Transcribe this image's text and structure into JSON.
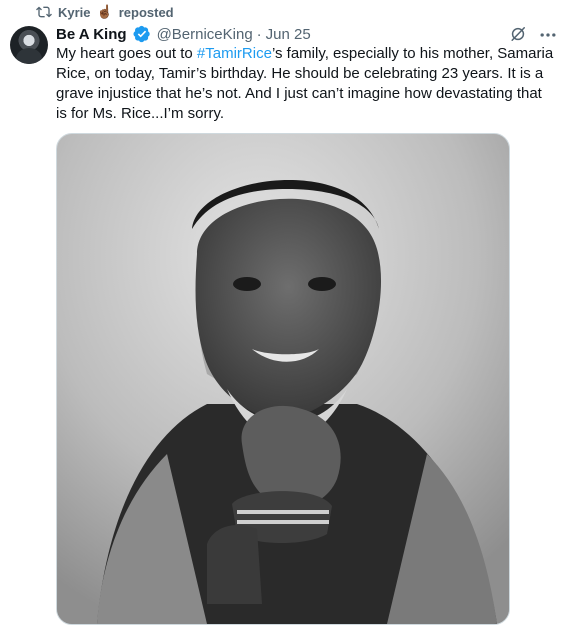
{
  "repost": {
    "icon": "repost-icon",
    "user": "Kyrie",
    "emoji": "☝🏾",
    "label": "reposted"
  },
  "author": {
    "avatar": "avatar",
    "name": "Be A King",
    "verified": true,
    "handle": "@BerniceKing",
    "separator": "·",
    "date": "Jun 25"
  },
  "tweet": {
    "text_before": "My heart goes out to ",
    "hashtag": "#TamirRice",
    "text_after": "’s family, especially to his mother, Samaria Rice, on today, Tamir’s birthday. He should be celebrating 23 years. It is a grave injustice that he’s not. And I just can’t imagine how devastating that is for Ms. Rice...I’m sorry."
  },
  "icons": {
    "grok": "grok-icon",
    "more": "more-icon"
  },
  "colors": {
    "text": "#0f1419",
    "secondary": "#536471",
    "link": "#1d9bf0",
    "verified": "#1d9bf0"
  }
}
